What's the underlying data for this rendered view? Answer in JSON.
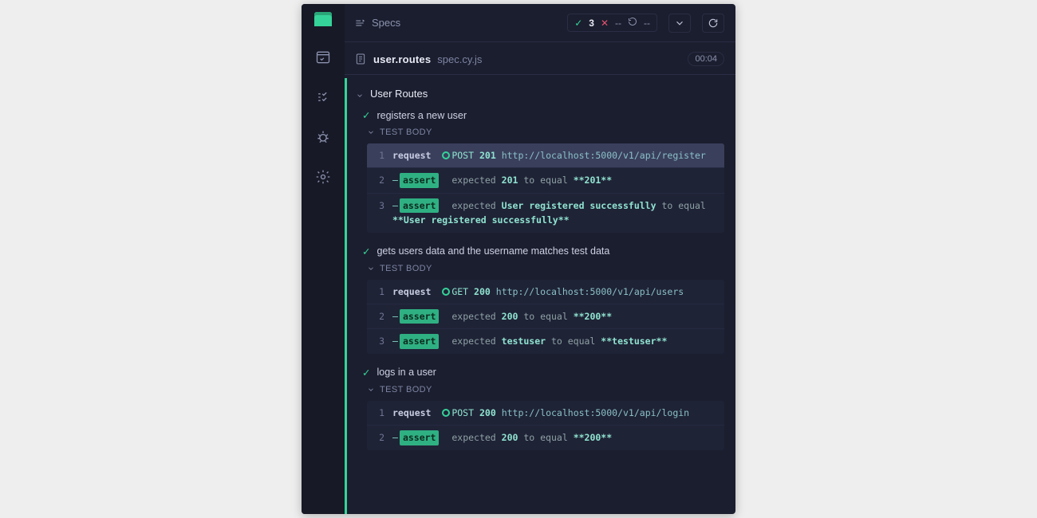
{
  "header": {
    "specs_label": "Specs",
    "passed": "3",
    "failed": "--",
    "pending": "--"
  },
  "spec": {
    "name": "user.routes",
    "ext": "spec.cy.js",
    "time": "00:04"
  },
  "suite": {
    "name": "User Routes"
  },
  "labels": {
    "test_body": "TEST BODY"
  },
  "tests": [
    {
      "title": "registers a new user",
      "commands": [
        {
          "num": "1",
          "type": "request",
          "method": "POST",
          "status": "201",
          "url": "http://localhost:5000/v1/api/register",
          "highlight": true
        },
        {
          "num": "2",
          "type": "assert",
          "text_pre": "expected ",
          "val1": "201",
          "mid": " to equal ",
          "val2": "**201**"
        },
        {
          "num": "3",
          "type": "assert",
          "text_pre": "expected ",
          "val1": "User registered successfully",
          "mid": " to equal ",
          "val2": "**User registered successfully**"
        }
      ]
    },
    {
      "title": "gets users data and the username matches test data",
      "commands": [
        {
          "num": "1",
          "type": "request",
          "method": "GET",
          "status": "200",
          "url": "http://localhost:5000/v1/api/users"
        },
        {
          "num": "2",
          "type": "assert",
          "text_pre": "expected ",
          "val1": "200",
          "mid": " to equal ",
          "val2": "**200**"
        },
        {
          "num": "3",
          "type": "assert",
          "text_pre": "expected ",
          "val1": "testuser",
          "mid": " to equal ",
          "val2": "**testuser**"
        }
      ]
    },
    {
      "title": "logs in a user",
      "commands": [
        {
          "num": "1",
          "type": "request",
          "method": "POST",
          "status": "200",
          "url": "http://localhost:5000/v1/api/login"
        },
        {
          "num": "2",
          "type": "assert",
          "text_pre": "expected ",
          "val1": "200",
          "mid": " to equal ",
          "val2": "**200**"
        }
      ]
    }
  ]
}
